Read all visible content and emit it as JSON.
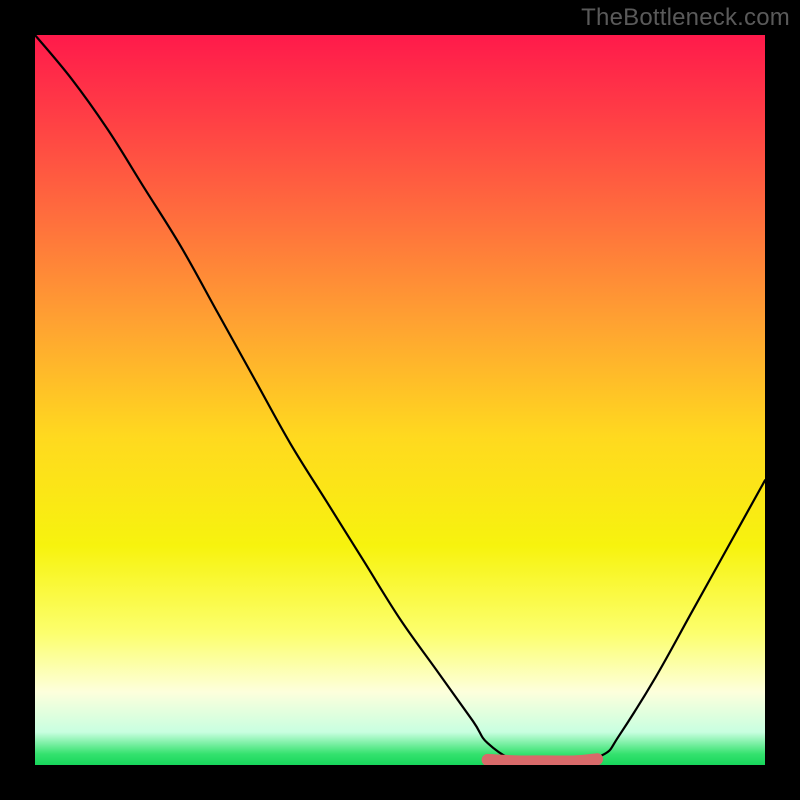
{
  "watermark": "TheBottleneck.com",
  "chart_data": {
    "type": "line",
    "title": "",
    "xlabel": "",
    "ylabel": "",
    "xlim": [
      0,
      100
    ],
    "ylim": [
      0,
      100
    ],
    "series": [
      {
        "name": "bottleneck-curve",
        "x": [
          0,
          5,
          10,
          15,
          20,
          25,
          30,
          35,
          40,
          45,
          50,
          55,
          60,
          62,
          66,
          70,
          74,
          78,
          80,
          85,
          90,
          95,
          100
        ],
        "values": [
          100,
          94,
          87,
          79,
          71,
          62,
          53,
          44,
          36,
          28,
          20,
          13,
          6,
          3,
          0.5,
          0.5,
          0.5,
          1.5,
          4,
          12,
          21,
          30,
          39
        ]
      },
      {
        "name": "optimal-zone",
        "x": [
          62,
          66,
          70,
          74,
          77
        ],
        "values": [
          0.7,
          0.5,
          0.5,
          0.5,
          0.8
        ]
      }
    ],
    "gradient_stops": [
      {
        "offset": 0.0,
        "color": "#ff1a4b"
      },
      {
        "offset": 0.1,
        "color": "#ff3a46"
      },
      {
        "offset": 0.25,
        "color": "#ff6e3d"
      },
      {
        "offset": 0.4,
        "color": "#ffa431"
      },
      {
        "offset": 0.55,
        "color": "#ffd91f"
      },
      {
        "offset": 0.7,
        "color": "#f7f30e"
      },
      {
        "offset": 0.82,
        "color": "#fcff6e"
      },
      {
        "offset": 0.9,
        "color": "#fdffdc"
      },
      {
        "offset": 0.955,
        "color": "#c8ffe0"
      },
      {
        "offset": 0.985,
        "color": "#34e26e"
      },
      {
        "offset": 1.0,
        "color": "#17d65b"
      }
    ],
    "optimal_color": "#d86a6a"
  }
}
